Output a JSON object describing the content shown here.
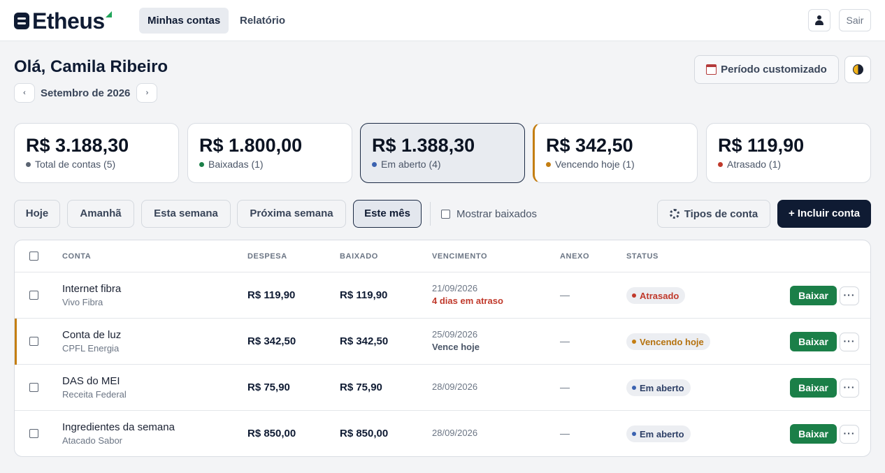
{
  "app": {
    "name": "Etheus"
  },
  "colors": {
    "brand": "#0f1b33",
    "accent_green": "#1b7f48",
    "warn": "#c47e12",
    "danger": "#c0392b",
    "info": "#3b62b0"
  },
  "nav": {
    "tabs": [
      {
        "label": "Minhas contas",
        "active": true
      },
      {
        "label": "Relatório",
        "active": false
      }
    ],
    "user_icon": "user-icon",
    "logout_label": "Sair"
  },
  "header": {
    "greeting": "Olá, Camila Ribeiro",
    "prev_label": "‹",
    "next_label": "›",
    "month_label": "Setembro de 2026",
    "period_label": "Período customizado",
    "period_icon": "calendar-icon",
    "theme_icon": "theme-toggle-icon"
  },
  "summary": [
    {
      "amount": "R$ 3.188,30",
      "label": "Total de contas (5)",
      "dot_color": "#5b6472",
      "selected": false
    },
    {
      "amount": "R$ 1.800,00",
      "label": "Baixadas (1)",
      "dot_color": "#1b7f48",
      "selected": false
    },
    {
      "amount": "R$ 1.388,30",
      "label": "Em aberto (4)",
      "dot_color": "#3b62b0",
      "selected": true
    },
    {
      "amount": "R$ 342,50",
      "label": "Vencendo hoje (1)",
      "dot_color": "#c47e12",
      "selected": false
    },
    {
      "amount": "R$ 119,90",
      "label": "Atrasado (1)",
      "dot_color": "#c0392b",
      "selected": false
    }
  ],
  "filters": {
    "items": [
      {
        "label": "Hoje",
        "active": false
      },
      {
        "label": "Amanhã",
        "active": false
      },
      {
        "label": "Esta semana",
        "active": false
      },
      {
        "label": "Próxima semana",
        "active": false
      },
      {
        "label": "Este mês",
        "active": true
      }
    ],
    "show_paid_label": "Mostrar baixados",
    "show_paid_checked": false,
    "types_label": "Tipos de conta",
    "add_label": "+ Incluir conta"
  },
  "table": {
    "columns": [
      "CONTA",
      "DESPESA",
      "BAIXADO",
      "VENCIMENTO",
      "ANEXO",
      "STATUS"
    ],
    "pay_label": "Baixar",
    "more_label": "···",
    "rows": [
      {
        "name": "Internet fibra",
        "sub": "Vivo Fibra",
        "expense": "R$ 119,90",
        "paid": "R$ 119,90",
        "due": "21/09/2026",
        "due_note": "4 dias em atraso",
        "attachment": "—",
        "status": "Atrasado"
      },
      {
        "name": "Conta de luz",
        "sub": "CPFL Energia",
        "expense": "R$ 342,50",
        "paid": "R$ 342,50",
        "due": "25/09/2026",
        "due_note": "Vence hoje",
        "attachment": "—",
        "status": "Vencendo hoje"
      },
      {
        "name": "DAS do MEI",
        "sub": "Receita Federal",
        "expense": "R$ 75,90",
        "paid": "R$ 75,90",
        "due": "28/09/2026",
        "due_note": "",
        "attachment": "—",
        "status": "Em aberto"
      },
      {
        "name": "Ingredientes da semana",
        "sub": "Atacado Sabor",
        "expense": "R$ 850,00",
        "paid": "R$ 850,00",
        "due": "28/09/2026",
        "due_note": "",
        "attachment": "—",
        "status": "Em aberto"
      }
    ]
  }
}
